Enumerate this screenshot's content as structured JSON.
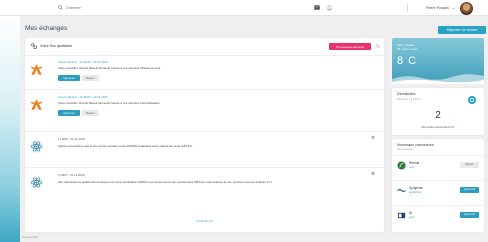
{
  "topbar": {
    "search_placeholder": "Chercher",
    "user_name": "Pierre Poulain",
    "icons": [
      "search-icon",
      "mail-icon",
      "bell-icon",
      "chevron-down-icon"
    ]
  },
  "page": {
    "title": "Mes échanges",
    "deposit_button": "Déposer un fichier"
  },
  "feed": {
    "title": "Votre flux quotidien",
    "new_badge": "15 nouveaux éléments",
    "items": [
      {
        "meta": "Fauvet Riviere · 11:43AM - 23.04.2020",
        "text": "Votre conseiller Vicouet Raoult demande l'accès à vos données Obesse au smé",
        "approve": "Approuvé",
        "reject": "Rejeter"
      },
      {
        "meta": "Fauvet Riviere · 11:43AM - 23.04.2020",
        "text": "Votre conseiller Vicouet Raoult demande l'accès à vos données Polenzalisation",
        "approve": "Approuvé",
        "reject": "Rejeter"
      },
      {
        "meta": "1 LDPA · 31.12.2019",
        "text": "Agrilot vous informe que le prix du blé meunier rendu ROUEN a dépassé votre objectif de vente (183 €/t)."
      },
      {
        "meta": "1 INPU · 31.12.2019",
        "text": "Afin d'améliorer la qualité des données pour votre certification CRDIS nous avons besoin de coordonnées IRPS de votre analyse de sol. pourriez-vous les indiquer ici ?"
      }
    ],
    "view_more": "VOIR PLUS"
  },
  "weather": {
    "location": "Saint, France",
    "description": "Bh, légères nuées",
    "temperature": "8 C"
  },
  "requests": {
    "title": "Demandes",
    "subtitle": "Mis à jour il y a 8 mn",
    "count": "2",
    "label": "Nouvelles demandes",
    "percent": "0%"
  },
  "connectors": {
    "title": "Nouveaux connectors",
    "subtitle": "Sotre services",
    "items": [
      {
        "name": "Rhenai",
        "sub": "goz7",
        "button": "Rejeter",
        "style": "grey"
      },
      {
        "name": "Syngenta",
        "sub": "goodvizies",
        "button": "Approuvé",
        "style": "blue"
      },
      {
        "name": "IA",
        "sub": "goz7",
        "button": "Approuvé",
        "style": "blue"
      }
    ]
  },
  "footer": {
    "text": "Connect 2020"
  },
  "colors": {
    "accent": "#29a3c4",
    "badge": "#e9336b",
    "logo_orange": "#f07f1e"
  }
}
